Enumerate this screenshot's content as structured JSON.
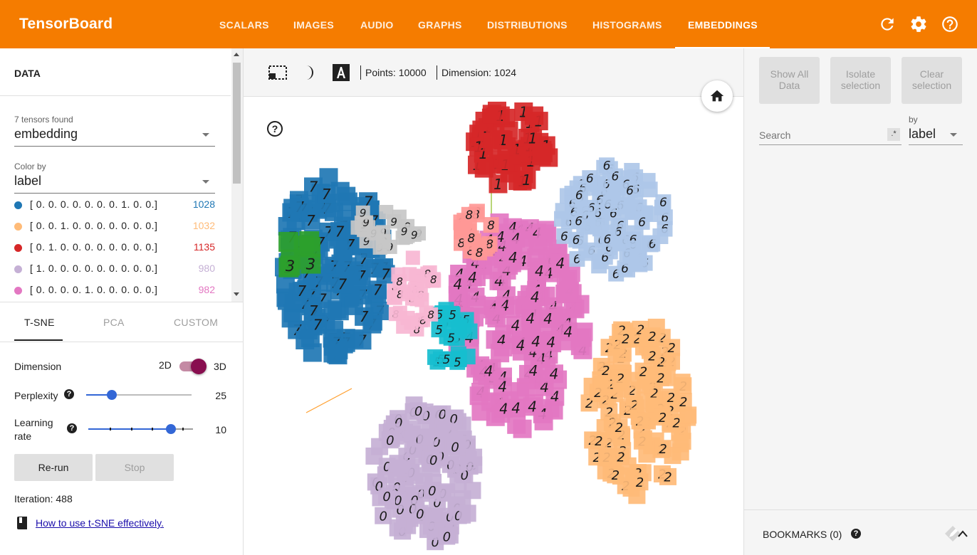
{
  "app": {
    "title": "TensorBoard",
    "tabs": [
      "SCALARS",
      "IMAGES",
      "AUDIO",
      "GRAPHS",
      "DISTRIBUTIONS",
      "HISTOGRAMS",
      "EMBEDDINGS"
    ],
    "active_tab": "EMBEDDINGS",
    "icons": [
      "refresh-icon",
      "settings-icon",
      "help-icon"
    ]
  },
  "data_panel": {
    "header": "DATA",
    "tensors_found": "7 tensors found",
    "tensor_selected": "embedding",
    "color_by_label": "Color by",
    "color_by_value": "label",
    "legend": [
      {
        "label": "[ 0. 0. 0. 0. 0. 0. 0. 1. 0. 0.]",
        "count": "1028",
        "color": "#1f77b4"
      },
      {
        "label": "[ 0. 0. 1. 0. 0. 0. 0. 0. 0. 0.]",
        "count": "1032",
        "color": "#ffbb78"
      },
      {
        "label": "[ 0. 1. 0. 0. 0. 0. 0. 0. 0. 0.]",
        "count": "1135",
        "color": "#d62728"
      },
      {
        "label": "[ 1. 0. 0. 0. 0. 0. 0. 0. 0. 0.]",
        "count": "980",
        "color": "#c5b0d5"
      },
      {
        "label": "[ 0. 0. 0. 0. 1. 0. 0. 0. 0. 0.]",
        "count": "982",
        "color": "#e377c2"
      }
    ]
  },
  "projection": {
    "tabs": [
      "T-SNE",
      "PCA",
      "CUSTOM"
    ],
    "active_tab": "T-SNE",
    "dimension_label": "Dimension",
    "dim_2d": "2D",
    "dim_3d": "3D",
    "dimension_value": "3D",
    "perplexity_label": "Perplexity",
    "perplexity_value": "25",
    "perplexity_fraction": 0.24,
    "learning_rate_label_1": "Learning",
    "learning_rate_label_2": "rate",
    "learning_rate_value": "10",
    "learning_rate_fraction": 0.79,
    "rerun_label": "Re-run",
    "stop_label": "Stop",
    "iteration_text": "Iteration: 488",
    "help_link": "How to use t-SNE effectively."
  },
  "toolbar": {
    "points_text": "Points: 10000",
    "dimension_text": "Dimension: 1024",
    "icons": [
      "select-rectangle-icon",
      "night-mode-icon",
      "labels-icon"
    ]
  },
  "inspector": {
    "show_all_label": "Show All Data",
    "isolate_label": "Isolate selection",
    "clear_label": "Clear selection",
    "search_placeholder": "Search",
    "regex_label": ".*",
    "by_label": "by",
    "by_value": "label",
    "bookmarks_label": "BOOKMARKS (0)"
  },
  "scatter": {
    "clusters": [
      {
        "color": "#1f77b4",
        "glyph": "7"
      },
      {
        "color": "#e377c2",
        "glyph": "4"
      },
      {
        "color": "#ffbb78",
        "glyph": "2"
      },
      {
        "color": "#c5b0d5",
        "glyph": "0"
      },
      {
        "color": "#aec7e8",
        "glyph": "6"
      },
      {
        "color": "#d62728",
        "glyph": "1"
      },
      {
        "color": "#2ca02c",
        "glyph": "3"
      },
      {
        "color": "#17becf",
        "glyph": "5"
      },
      {
        "color": "#c7c7c7",
        "glyph": "9"
      },
      {
        "color": "#ff9896",
        "glyph": "8"
      },
      {
        "color": "#f7b6d2",
        "glyph": "8"
      }
    ]
  }
}
